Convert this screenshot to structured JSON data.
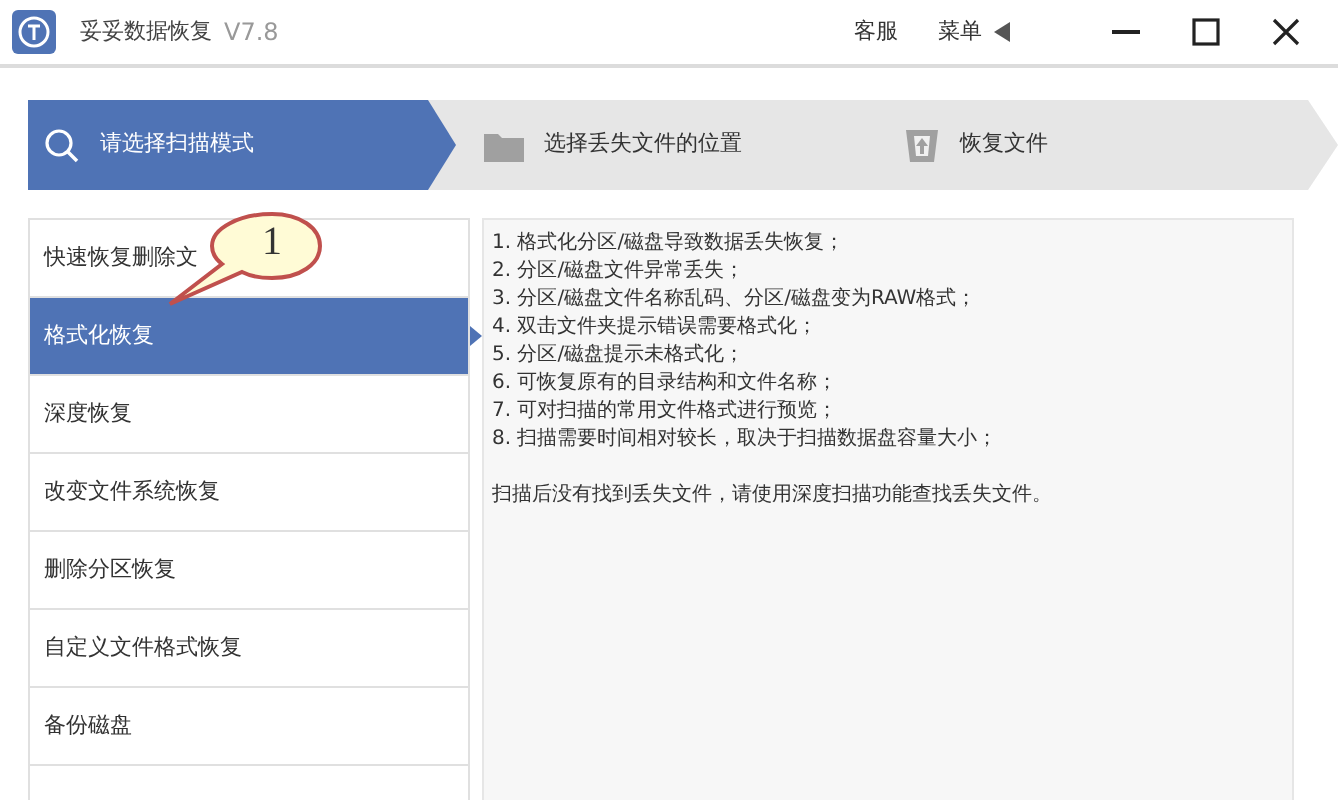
{
  "window": {
    "title": "妥妥数据恢复",
    "version": "V7.8",
    "links": [
      "客服",
      "菜单"
    ]
  },
  "steps": [
    {
      "label": "请选择扫描模式",
      "selected": true,
      "kind": "search"
    },
    {
      "label": "选择丢失文件的位置",
      "selected": false,
      "kind": "folder"
    },
    {
      "label": "恢复文件",
      "selected": false,
      "kind": "restore"
    }
  ],
  "modes": [
    {
      "label": "快速恢复删除文",
      "selected": false
    },
    {
      "label": "格式化恢复",
      "selected": true
    },
    {
      "label": "深度恢复",
      "selected": false
    },
    {
      "label": "改变文件系统恢复",
      "selected": false
    },
    {
      "label": "删除分区恢复",
      "selected": false
    },
    {
      "label": "自定义文件格式恢复",
      "selected": false
    },
    {
      "label": "备份磁盘",
      "selected": false
    }
  ],
  "description": {
    "items": [
      "1. 格式化分区/磁盘导致数据丢失恢复；",
      "2. 分区/磁盘文件异常丢失；",
      "3. 分区/磁盘文件名称乱码、分区/磁盘变为RAW格式；",
      "4. 双击文件夹提示错误需要格式化；",
      "5. 分区/磁盘提示未格式化；",
      "6. 可恢复原有的目录结构和文件名称；",
      "7. 可对扫描的常用文件格式进行预览；",
      "8. 扫描需要时间相对较长，取决于扫描数据盘容量大小；"
    ],
    "note": "扫描后没有找到丢失文件，请使用深度扫描功能查找丢失文件。"
  },
  "callout": {
    "number": "1"
  }
}
